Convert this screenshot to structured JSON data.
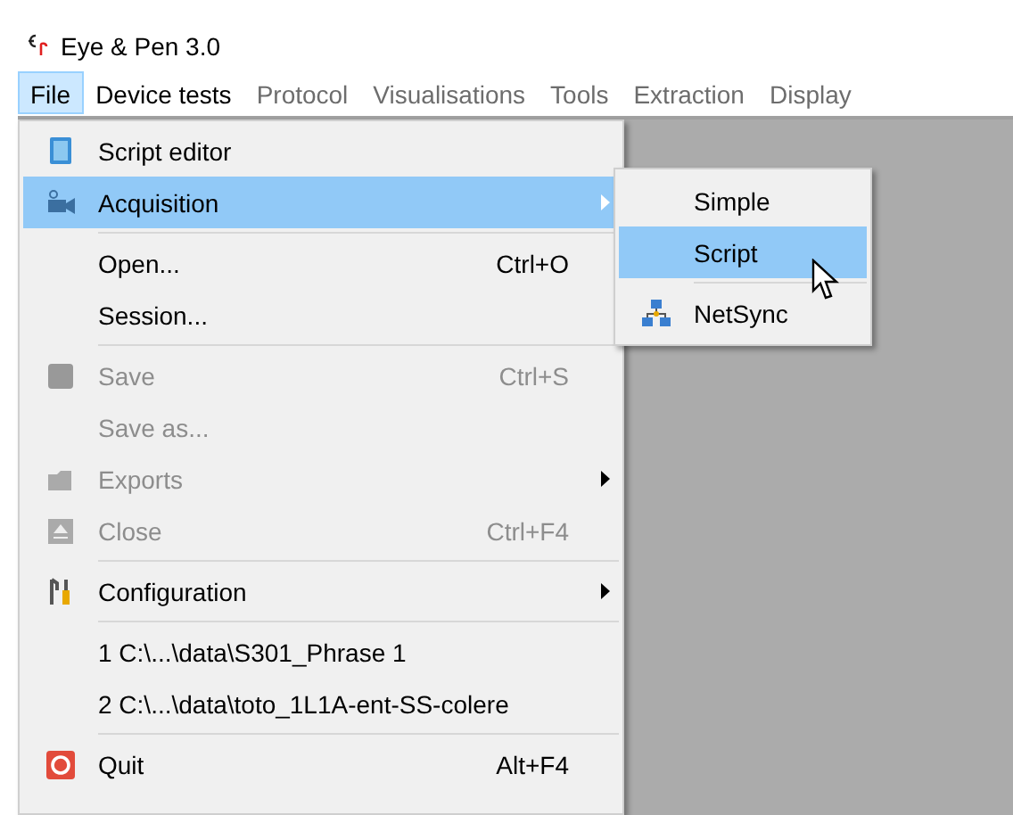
{
  "window": {
    "title": "Eye & Pen 3.0"
  },
  "menubar": [
    {
      "label": "File",
      "selected": true,
      "disabled": false
    },
    {
      "label": "Device tests",
      "selected": false,
      "disabled": false
    },
    {
      "label": "Protocol",
      "selected": false,
      "disabled": true
    },
    {
      "label": "Visualisations",
      "selected": false,
      "disabled": true
    },
    {
      "label": "Tools",
      "selected": false,
      "disabled": true
    },
    {
      "label": "Extraction",
      "selected": false,
      "disabled": true
    },
    {
      "label": "Display",
      "selected": false,
      "disabled": true
    }
  ],
  "file_menu": [
    {
      "kind": "item",
      "label": "Script editor",
      "selected": false,
      "disabled": false,
      "submenu": false
    },
    {
      "kind": "item",
      "label": "Acquisition",
      "selected": true,
      "disabled": false,
      "submenu": true
    },
    {
      "kind": "separator"
    },
    {
      "kind": "item",
      "label": "Open...",
      "shortcut": "Ctrl+O",
      "selected": false,
      "disabled": false,
      "submenu": false
    },
    {
      "kind": "item",
      "label": "Session...",
      "selected": false,
      "disabled": false,
      "submenu": false
    },
    {
      "kind": "separator"
    },
    {
      "kind": "item",
      "label": "Save",
      "shortcut": "Ctrl+S",
      "selected": false,
      "disabled": true,
      "submenu": false
    },
    {
      "kind": "item",
      "label": "Save as...",
      "selected": false,
      "disabled": true,
      "submenu": false
    },
    {
      "kind": "item",
      "label": "Exports",
      "selected": false,
      "disabled": true,
      "submenu": true
    },
    {
      "kind": "item",
      "label": "Close",
      "shortcut": "Ctrl+F4",
      "selected": false,
      "disabled": true,
      "submenu": false
    },
    {
      "kind": "separator"
    },
    {
      "kind": "item",
      "label": "Configuration",
      "selected": false,
      "disabled": false,
      "submenu": true
    },
    {
      "kind": "separator"
    },
    {
      "kind": "item",
      "label": "1 C:\\...\\data\\S301_Phrase 1",
      "selected": false,
      "disabled": false,
      "submenu": false
    },
    {
      "kind": "item",
      "label": "2 C:\\...\\data\\toto_1L1A-ent-SS-colere",
      "selected": false,
      "disabled": false,
      "submenu": false
    },
    {
      "kind": "separator"
    },
    {
      "kind": "item",
      "label": "Quit",
      "shortcut": "Alt+F4",
      "selected": false,
      "disabled": false,
      "submenu": false
    }
  ],
  "acquisition_submenu": [
    {
      "kind": "item",
      "label": "Simple",
      "selected": false
    },
    {
      "kind": "item",
      "label": "Script",
      "selected": true
    },
    {
      "kind": "separator"
    },
    {
      "kind": "item",
      "label": "NetSync",
      "selected": false
    }
  ]
}
